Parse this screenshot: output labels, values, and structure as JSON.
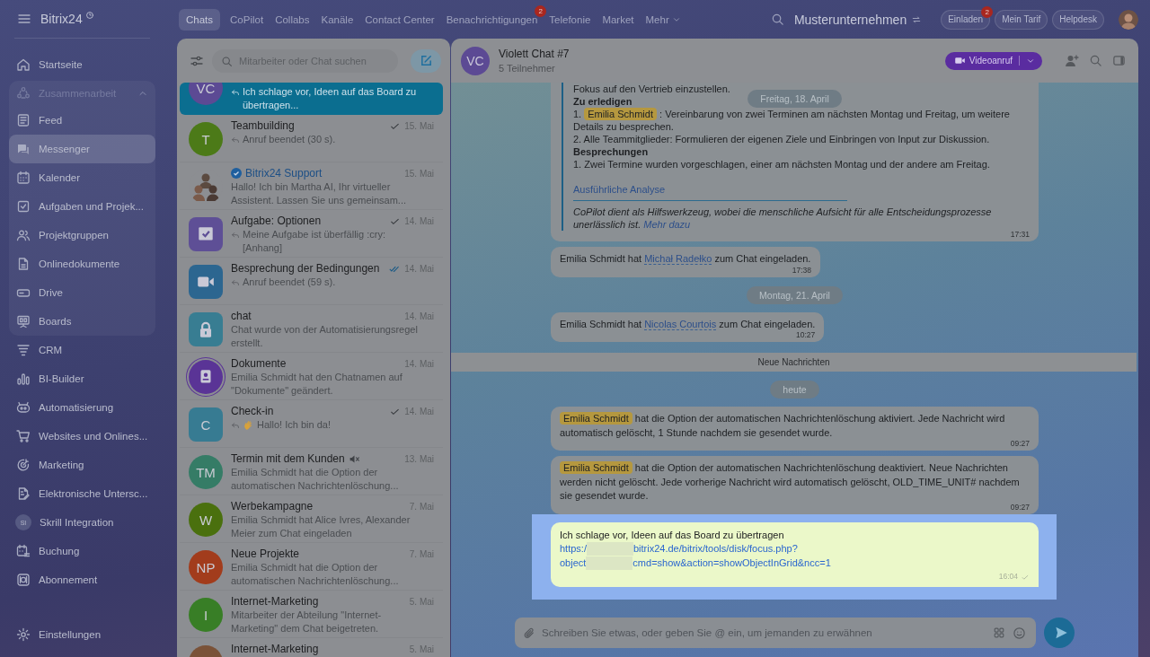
{
  "sidebar": {
    "logo": "Bitrix24",
    "items": [
      {
        "label": "Startseite",
        "selected": false
      },
      {
        "label": "Zusammenarbeit",
        "selected": false,
        "expanded": true,
        "children": [
          {
            "label": "Feed",
            "selected": false
          },
          {
            "label": "Messenger",
            "selected": true
          },
          {
            "label": "Kalender",
            "selected": false
          },
          {
            "label": "Aufgaben und Projek...",
            "selected": false
          },
          {
            "label": "Projektgruppen",
            "selected": false
          },
          {
            "label": "Onlinedokumente",
            "selected": false
          },
          {
            "label": "Drive",
            "selected": false
          },
          {
            "label": "Boards",
            "selected": false
          }
        ]
      },
      {
        "label": "CRM",
        "selected": false
      },
      {
        "label": "BI-Builder",
        "selected": false
      },
      {
        "label": "Automatisierung",
        "selected": false
      },
      {
        "label": "Websites und Onlines...",
        "selected": false
      },
      {
        "label": "Marketing",
        "selected": false
      },
      {
        "label": "Elektronische Untersc...",
        "selected": false
      },
      {
        "label": "Skrill Integration",
        "selected": false,
        "avatar": "SI"
      },
      {
        "label": "Buchung",
        "selected": false
      },
      {
        "label": "Abonnement",
        "selected": false
      }
    ],
    "settings": "Einstellungen"
  },
  "topbar": {
    "tabs": [
      {
        "label": "Chats",
        "selected": true
      },
      {
        "label": "CoPilot",
        "selected": false
      },
      {
        "label": "Collabs",
        "selected": false
      },
      {
        "label": "Kanäle",
        "selected": false
      },
      {
        "label": "Contact Center",
        "selected": false
      },
      {
        "label": "Benachrichtigungen",
        "selected": false,
        "badge": "2"
      },
      {
        "label": "Telefonie",
        "selected": false
      },
      {
        "label": "Market",
        "selected": false
      },
      {
        "label": "Mehr",
        "selected": false,
        "dropdown": true
      }
    ],
    "company": "Musterunternehmen",
    "buttons": [
      {
        "label": "Einladen",
        "badge": "2"
      },
      {
        "label": "Mein Tarif"
      },
      {
        "label": "Helpdesk"
      }
    ]
  },
  "chat_list": {
    "search": {
      "placeholder": "Mitarbeiter oder Chat suchen"
    },
    "chats": [
      {
        "preview": "Ich schlage vor, Ideen auf das Board zu übertragen...",
        "selected": true,
        "reply": true,
        "avatar": {
          "kind": "initials",
          "text": "VC",
          "color": "#5c4a94"
        }
      },
      {
        "title": "Teambuilding",
        "preview": "Anruf beendet (30 s).",
        "date": "15. Mai",
        "selected": false,
        "reply": true,
        "sent": true,
        "read": false,
        "avatar": {
          "kind": "initials",
          "text": "T",
          "color": "#4c7a18"
        }
      },
      {
        "title": "Bitrix24 Support",
        "official": true,
        "preview": "Hallo! Ich bin Martha AI, Ihr virtueller Assistent. Lassen Sie uns gemeinsam...",
        "date": "15. Mai",
        "selected": false,
        "reply": false,
        "sent": false,
        "read": false
      },
      {
        "title": "Aufgabe: Optionen",
        "preview": "Meine Aufgabe ist überfällig :cry: [Anhang]",
        "date": "14. Mai",
        "selected": false,
        "reply": true,
        "sent": true,
        "read": false,
        "avatar": {
          "kind": "task",
          "color": "#5e4f96"
        }
      },
      {
        "title": "Besprechung der Bedingungen",
        "preview": "Anruf beendet (59 s).",
        "date": "14. Mai",
        "selected": false,
        "reply": true,
        "sent": true,
        "read": true,
        "avatar": {
          "kind": "video",
          "color": "#2c6690"
        }
      },
      {
        "title": "chat",
        "preview": "Chat wurde von der Automatisierungsregel erstellt.",
        "date": "14. Mai",
        "selected": false,
        "reply": false,
        "sent": false,
        "read": false,
        "avatar": {
          "kind": "lock",
          "color": "#387d92"
        }
      },
      {
        "title": "Dokumente",
        "preview": "Emilia Schmidt hat den Chatnamen auf \"Dokumente\" geändert.",
        "date": "14. Mai",
        "selected": false,
        "reply": false,
        "sent": false,
        "read": false,
        "avatar": {
          "kind": "document",
          "color": "#5a3496"
        }
      },
      {
        "title": "Check-in",
        "wave": true,
        "preview": "Hallo! Ich bin da!",
        "date": "14. Mai",
        "selected": false,
        "reply": true,
        "sent": true,
        "read": false,
        "avatar": {
          "kind": "tile",
          "text": "C",
          "color": "#377b92"
        }
      },
      {
        "title": "Termin mit dem Kunden",
        "muted": true,
        "preview": "Emilia Schmidt hat die Option der automatischen Nachrichtenlöschung...",
        "date": "13. Mai",
        "selected": false,
        "reply": false,
        "sent": false,
        "read": false,
        "avatar": {
          "kind": "initials",
          "text": "TM",
          "color": "#357c66"
        }
      },
      {
        "title": "Werbekampagne",
        "preview": "Emilia Schmidt hat Alice Ivres, Alexander Meier zum Chat eingeladen",
        "date": "7. Mai",
        "selected": false,
        "reply": false,
        "sent": false,
        "read": false,
        "avatar": {
          "kind": "initials",
          "text": "W",
          "color": "#4a700e"
        }
      },
      {
        "title": "Neue Projekte",
        "preview": "Emilia Schmidt hat die Option der automatischen Nachrichtenlöschung...",
        "date": "7. Mai",
        "selected": false,
        "reply": false,
        "sent": false,
        "read": false,
        "avatar": {
          "kind": "initials",
          "text": "NP",
          "color": "#a23c1c"
        }
      },
      {
        "title": "Internet-Marketing",
        "preview": "Mitarbeiter der Abteilung \"Internet-Marketing\" dem Chat beigetreten.",
        "date": "5. Mai",
        "selected": false,
        "reply": false,
        "sent": false,
        "read": false,
        "avatar": {
          "kind": "initials",
          "text": "I",
          "color": "#387e26"
        }
      },
      {
        "title": "Internet-Marketing",
        "date": "5. Mai",
        "selected": false,
        "sent": false,
        "read": false,
        "avatar": {
          "kind": "initials",
          "color": "#7a5238"
        }
      }
    ]
  },
  "chat": {
    "avatar": "VC",
    "title": "Violett Chat #7",
    "subtitle": "5 Teilnehmer",
    "video_button": "Videoanruf",
    "sticky_date": "Freitag, 18. April",
    "messages": [
      {
        "kind": "copilot",
        "lines": [
          {
            "kind": "text",
            "text": "Fokus auf den Vertrieb einzustellen."
          },
          {
            "kind": "heading",
            "text": "Zu erledigen"
          },
          {
            "kind": "mention",
            "prefix": "1.",
            "mention": "Emilia Schmidt",
            "text": ": Vereinbarung von zwei Terminen am nächsten Montag und Freitag, um weitere Details zu besprechen."
          },
          {
            "kind": "text",
            "text": "2. Alle Teammitglieder: Formulieren der eigenen Ziele und Einbringen von Input zur Diskussion."
          },
          {
            "kind": "heading",
            "text": "Besprechungen"
          },
          {
            "kind": "text",
            "text": "1. Zwei Termine wurden vorgeschlagen, einer am nächsten Montag und der andere am Freitag."
          }
        ],
        "link": "Ausführliche Analyse",
        "note": "CoPilot dient als Hilfswerkzeug, wobei die menschliche Aufsicht für alle Entscheidungsprozesse unerlässlich ist.",
        "note_link": "Mehr dazu",
        "time": "17:31"
      },
      {
        "kind": "system",
        "before": "Emilia Schmidt hat",
        "link": "Michał Radełko",
        "after": "zum Chat eingeladen.",
        "time": "17:38"
      },
      {
        "kind": "date",
        "text": "Montag, 21. April"
      },
      {
        "kind": "system",
        "before": "Emilia Schmidt hat",
        "link": "Nicolas Courtois",
        "after": "zum Chat eingeladen.",
        "time": "10:27"
      },
      {
        "kind": "divider",
        "text": "Neue Nachrichten"
      },
      {
        "kind": "date",
        "text": "heute"
      },
      {
        "kind": "mention",
        "mention": "Emilia Schmidt",
        "text": "hat die Option der automatischen Nachrichtenlöschung aktiviert. Jede Nachricht wird automatisch gelöscht, 1 Stunde nachdem sie gesendet wurde.",
        "time": "09:27"
      },
      {
        "kind": "mention",
        "mention": "Emilia Schmidt",
        "text": "hat die Option der automatischen Nachrichtenlöschung deaktiviert. Neue Nachrichten werden nicht gelöscht. Jede vorherige Nachricht wird automatisch gelöscht, OLD_TIME_UNIT# nachdem sie gesendet wurde.",
        "time": "09:27"
      },
      {
        "kind": "own",
        "highlighted": true,
        "text": "Ich schlage vor, Ideen auf das Board zu übertragen",
        "link_lines": [
          {
            "before": "https:/",
            "after": "bitrix24.de/bitrix/tools/disk/focus.php?"
          },
          {
            "before": "object",
            "after": "cmd=show&action=showObjectInGrid&ncc=1"
          }
        ],
        "time": "16:04",
        "sent": true
      }
    ],
    "composer": {
      "placeholder": "Schreiben Sie etwas, oder geben Sie @ ein, um jemanden zu erwähnen"
    }
  }
}
